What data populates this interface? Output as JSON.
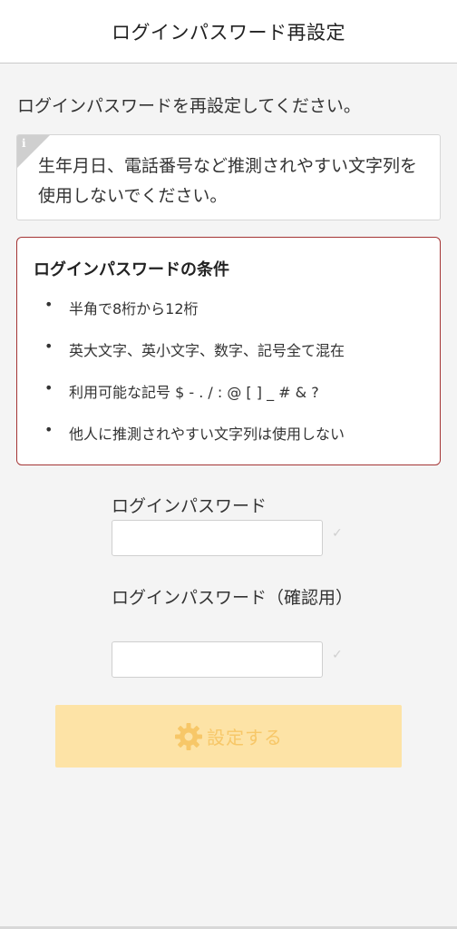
{
  "header": {
    "title": "ログインパスワード再設定"
  },
  "intro": {
    "text": "ログインパスワードを再設定してください。"
  },
  "info": {
    "icon": "info-icon",
    "text": "生年月日、電話番号など推測されやすい文字列を使用しないでください。"
  },
  "conditions": {
    "title": "ログインパスワードの条件",
    "items": [
      "半角で8桁から12桁",
      "英大文字、英小文字、数字、記号全て混在",
      "利用可能な記号 $ - . / : @ [ ] _ # & ?",
      "他人に推測されやすい文字列は使用しない"
    ]
  },
  "form": {
    "password_label": "ログインパスワード",
    "password_value": "",
    "confirm_label": "ログインパスワード（確認用）",
    "confirm_value": "",
    "check_icon": "✓"
  },
  "submit": {
    "label": "設定する",
    "icon": "gear-icon",
    "enabled": false
  },
  "colors": {
    "accent_border": "#a43434",
    "button_bg": "#fde3a6",
    "button_fg": "#f7c768"
  }
}
